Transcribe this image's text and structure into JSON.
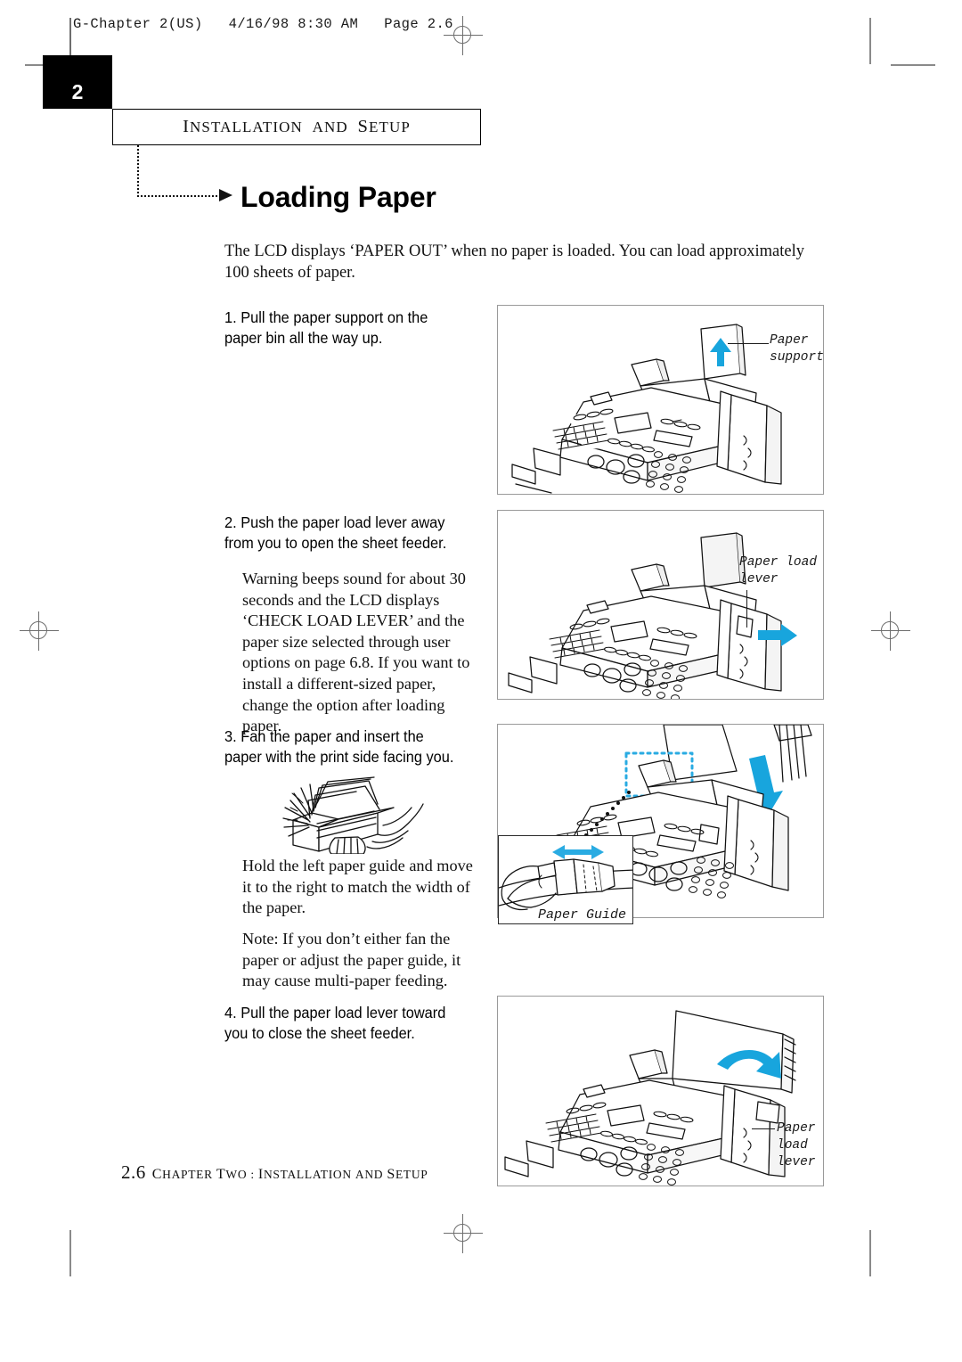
{
  "print_slug": "G-Chapter 2(US)   4/16/98 8:30 AM   Page 2.6",
  "chapter_tab": {
    "number": "2"
  },
  "running_head": {
    "full": "INSTALLATION AND SETUP",
    "part1_cap": "I",
    "part1_rest": "NSTALLATION",
    "part2": "AND",
    "part3_cap": "S",
    "part3_rest": "ETUP"
  },
  "title": "Loading Paper",
  "intro": "The LCD displays ‘PAPER OUT’ when no paper is loaded. You can load approximately 100 sheets of paper.",
  "steps": [
    {
      "number": "1.",
      "text": "Pull the paper support on the paper bin all the way up."
    },
    {
      "number": "2.",
      "text": "Push the paper load lever away from you to open the sheet feeder.",
      "body": "Warning beeps sound for about 30 seconds and the LCD displays ‘CHECK LOAD LEVER’ and the paper size selected through user options on page 6.8. If you want to install a different-sized paper, change the option after loading paper."
    },
    {
      "number": "3.",
      "text": "Fan the paper and insert the paper with the print side facing you.",
      "body": "Hold the left paper guide and move it to the right to match the width of the paper.",
      "note": "Note: If you don’t either fan the paper or adjust the paper guide, it may cause multi-paper feeding."
    },
    {
      "number": "4.",
      "text": "Pull the paper load lever toward you to close the sheet feeder."
    }
  ],
  "figures": [
    {
      "name": "paper-support-figure",
      "callout": "Paper\nsupport"
    },
    {
      "name": "paper-load-lever-open-figure",
      "callout": "Paper load\nlever"
    },
    {
      "name": "insert-paper-figure",
      "inset_callout": "Paper Guide"
    },
    {
      "name": "paper-load-lever-close-figure",
      "callout": "Paper\nload\nlever"
    }
  ],
  "footer": {
    "folio": "2.6",
    "full": "CHAPTER TWO : INSTALLATION AND SETUP",
    "c1": "C",
    "c1r": "HAPTER",
    "c2": "T",
    "c2r": "WO",
    "colon": ":",
    "c3": "I",
    "c3r": "NSTALLATION",
    "c4": "AND",
    "c5": "S",
    "c5r": "ETUP"
  },
  "colors": {
    "arrow_blue": "#18a5dd",
    "panel_border": "#9a9a9a",
    "mark_gray": "#8a8a8a"
  }
}
